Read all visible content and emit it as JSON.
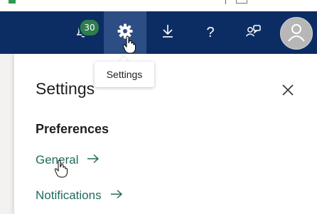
{
  "header": {
    "notifications_count": "30",
    "icons": [
      "bell-icon",
      "gear-icon",
      "download-icon",
      "help-icon",
      "feedback-icon",
      "user-avatar-icon"
    ],
    "help_glyph": "?",
    "bg_color": "#0b2d63",
    "active_bg_color": "#2c4e84",
    "badge_color": "#2e7d4d"
  },
  "tooltip": {
    "text": "Settings"
  },
  "panel": {
    "title": "Settings",
    "section_heading": "Preferences",
    "links": [
      {
        "label": "General"
      },
      {
        "label": "Notifications"
      }
    ],
    "link_color": "#1f6b5c"
  }
}
